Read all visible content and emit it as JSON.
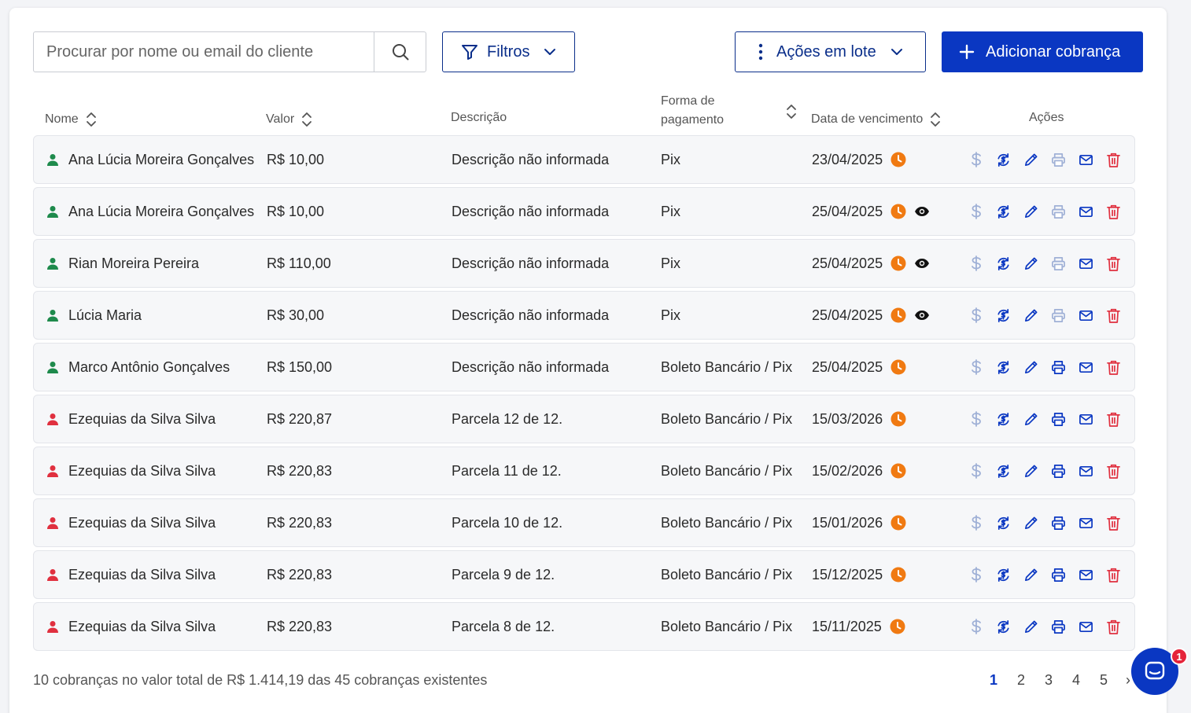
{
  "toolbar": {
    "search_placeholder": "Procurar por nome ou email do cliente",
    "filters_label": "Filtros",
    "batch_label": "Ações em lote",
    "add_label": "Adicionar cobrança"
  },
  "table": {
    "columns": {
      "name": "Nome",
      "value": "Valor",
      "description": "Descrição",
      "payment_line1": "Forma de",
      "payment_line2": "pagamento",
      "due_date": "Data de vencimento",
      "actions": "Ações"
    },
    "rows": [
      {
        "name": "Ana Lúcia Moreira Gonçalves",
        "status": "green",
        "value": "R$ 10,00",
        "description": "Descrição não informada",
        "payment": "Pix",
        "due_date": "23/04/2025",
        "viewed": false,
        "print_enabled": false
      },
      {
        "name": "Ana Lúcia Moreira Gonçalves",
        "status": "green",
        "value": "R$ 10,00",
        "description": "Descrição não informada",
        "payment": "Pix",
        "due_date": "25/04/2025",
        "viewed": true,
        "print_enabled": false
      },
      {
        "name": "Rian Moreira Pereira",
        "status": "green",
        "value": "R$ 110,00",
        "description": "Descrição não informada",
        "payment": "Pix",
        "due_date": "25/04/2025",
        "viewed": true,
        "print_enabled": false
      },
      {
        "name": "Lúcia Maria",
        "status": "green",
        "value": "R$ 30,00",
        "description": "Descrição não informada",
        "payment": "Pix",
        "due_date": "25/04/2025",
        "viewed": true,
        "print_enabled": false
      },
      {
        "name": "Marco Antônio Gonçalves",
        "status": "green",
        "value": "R$ 150,00",
        "description": "Descrição não informada",
        "payment": "Boleto Bancário / Pix",
        "due_date": "25/04/2025",
        "viewed": false,
        "print_enabled": true
      },
      {
        "name": "Ezequias da Silva Silva",
        "status": "red",
        "value": "R$ 220,87",
        "description": "Parcela 12 de 12.",
        "payment": "Boleto Bancário / Pix",
        "due_date": "15/03/2026",
        "viewed": false,
        "print_enabled": true
      },
      {
        "name": "Ezequias da Silva Silva",
        "status": "red",
        "value": "R$ 220,83",
        "description": "Parcela 11 de 12.",
        "payment": "Boleto Bancário / Pix",
        "due_date": "15/02/2026",
        "viewed": false,
        "print_enabled": true
      },
      {
        "name": "Ezequias da Silva Silva",
        "status": "red",
        "value": "R$ 220,83",
        "description": "Parcela 10 de 12.",
        "payment": "Boleto Bancário / Pix",
        "due_date": "15/01/2026",
        "viewed": false,
        "print_enabled": true
      },
      {
        "name": "Ezequias da Silva Silva",
        "status": "red",
        "value": "R$ 220,83",
        "description": "Parcela 9 de 12.",
        "payment": "Boleto Bancário / Pix",
        "due_date": "15/12/2025",
        "viewed": false,
        "print_enabled": true
      },
      {
        "name": "Ezequias da Silva Silva",
        "status": "red",
        "value": "R$ 220,83",
        "description": "Parcela 8 de 12.",
        "payment": "Boleto Bancário / Pix",
        "due_date": "15/11/2025",
        "viewed": false,
        "print_enabled": true
      }
    ]
  },
  "footer": {
    "summary": "10 cobranças no valor total de R$ 1.414,19 das 45 cobranças existentes",
    "pages": [
      "1",
      "2",
      "3",
      "4",
      "5"
    ],
    "current_page": "1"
  },
  "chat": {
    "badge": "1"
  },
  "colors": {
    "primary": "#0a37c2",
    "navy": "#0a2e8a",
    "status_green": "#1e8a4c",
    "status_red": "#e0303f",
    "clock_orange": "#f07a12",
    "delete_red": "#e0303f",
    "disabled_icon": "#9fb0d6"
  }
}
